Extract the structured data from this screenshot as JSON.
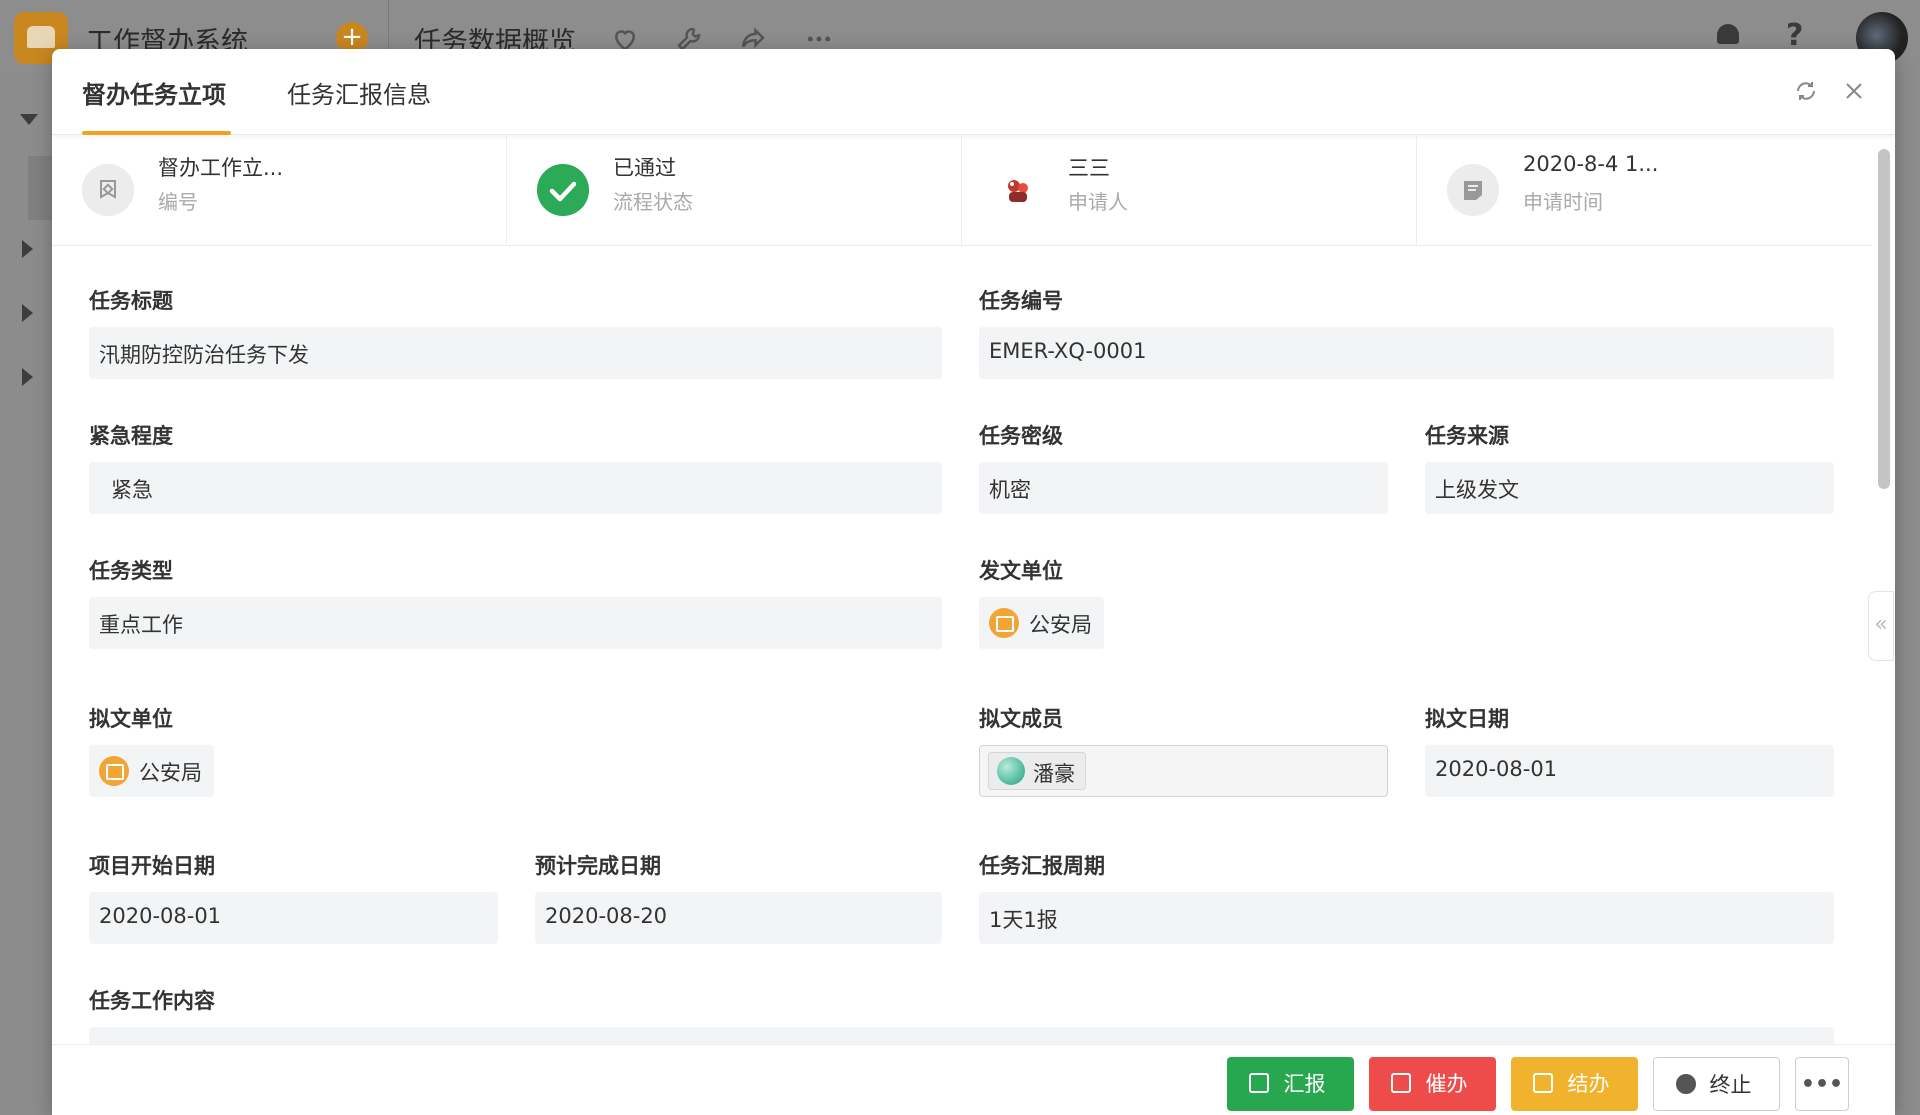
{
  "app": {
    "title": "工作督办系统",
    "add_label": "+",
    "page_title": "任务数据概览",
    "help_label": "?",
    "icons": [
      "heart-icon",
      "wrench-icon",
      "share-icon",
      "more-icon",
      "bell-icon",
      "help-icon"
    ]
  },
  "modal": {
    "tabs": [
      {
        "label": "督办任务立项",
        "active": true
      },
      {
        "label": "任务汇报信息",
        "active": false
      }
    ],
    "summary": [
      {
        "value": "督办工作立...",
        "label": "编号",
        "icon": "tag-icon"
      },
      {
        "value": "已通过",
        "label": "流程状态",
        "icon": "check-circle-icon"
      },
      {
        "value": "三三",
        "label": "申请人",
        "icon": "user-avatar-icon"
      },
      {
        "value": "2020-8-4 1...",
        "label": "申请时间",
        "icon": "note-icon"
      }
    ],
    "fields": {
      "task_title": {
        "label": "任务标题",
        "value": "汛期防控防治任务下发"
      },
      "task_no": {
        "label": "任务编号",
        "value": "EMER-XQ-0001"
      },
      "urgency": {
        "label": "紧急程度",
        "value": "紧急"
      },
      "secret_level": {
        "label": "任务密级",
        "value": "机密"
      },
      "source": {
        "label": "任务来源",
        "value": "上级发文"
      },
      "task_type": {
        "label": "任务类型",
        "value": "重点工作"
      },
      "issuing_unit": {
        "label": "发文单位",
        "value": "公安局"
      },
      "drafting_unit": {
        "label": "拟文单位",
        "value": "公安局"
      },
      "drafting_member": {
        "label": "拟文成员",
        "value": "潘豪"
      },
      "drafting_date": {
        "label": "拟文日期",
        "value": "2020-08-01"
      },
      "start_date": {
        "label": "项目开始日期",
        "value": "2020-08-01"
      },
      "expected_date": {
        "label": "预计完成日期",
        "value": "2020-08-20"
      },
      "report_cycle": {
        "label": "任务汇报周期",
        "value": "1天1报"
      },
      "content": {
        "label": "任务工作内容",
        "value": ""
      }
    },
    "actions": {
      "report": "汇报",
      "urge": "催办",
      "finish": "结办",
      "stop": "终止",
      "more": "•••"
    },
    "colors": {
      "accent": "#f0a322",
      "report": "#27a84f",
      "urge": "#ee4b4b",
      "finish": "#f1b22d",
      "status_ok": "#2daa57"
    }
  }
}
